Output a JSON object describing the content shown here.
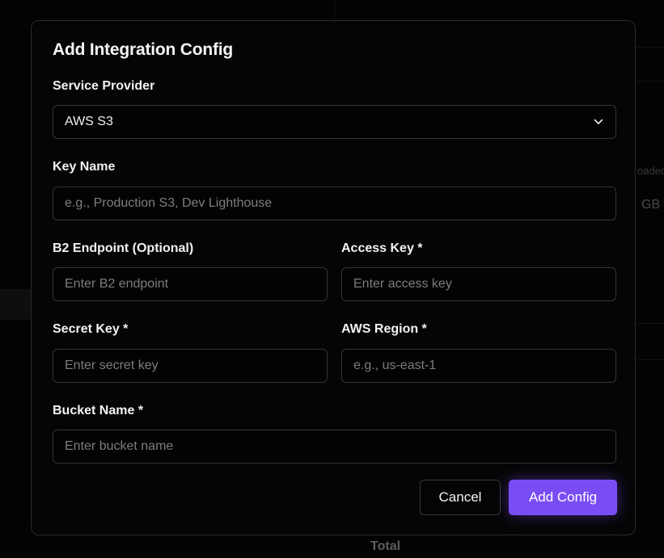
{
  "background": {
    "fragment_uploaded": "oaded",
    "fragment_gb": "GB",
    "fragment_total": "Total"
  },
  "modal": {
    "title": "Add Integration Config",
    "service_provider": {
      "label": "Service Provider",
      "selected": "AWS S3"
    },
    "key_name": {
      "label": "Key Name",
      "placeholder": "e.g., Production S3, Dev Lighthouse"
    },
    "b2_endpoint": {
      "label": "B2 Endpoint (Optional)",
      "placeholder": "Enter B2 endpoint"
    },
    "access_key": {
      "label": "Access Key *",
      "placeholder": "Enter access key"
    },
    "secret_key": {
      "label": "Secret Key *",
      "placeholder": "Enter secret key"
    },
    "aws_region": {
      "label": "AWS Region *",
      "placeholder": "e.g., us-east-1"
    },
    "bucket_name": {
      "label": "Bucket Name *",
      "placeholder": "Enter bucket name"
    },
    "actions": {
      "cancel": "Cancel",
      "submit": "Add Config"
    }
  },
  "colors": {
    "accent": "#7a4df4",
    "modal_bg": "#050505",
    "border": "#343434"
  },
  "icons": {
    "select_chevron": "chevron-down-icon"
  }
}
